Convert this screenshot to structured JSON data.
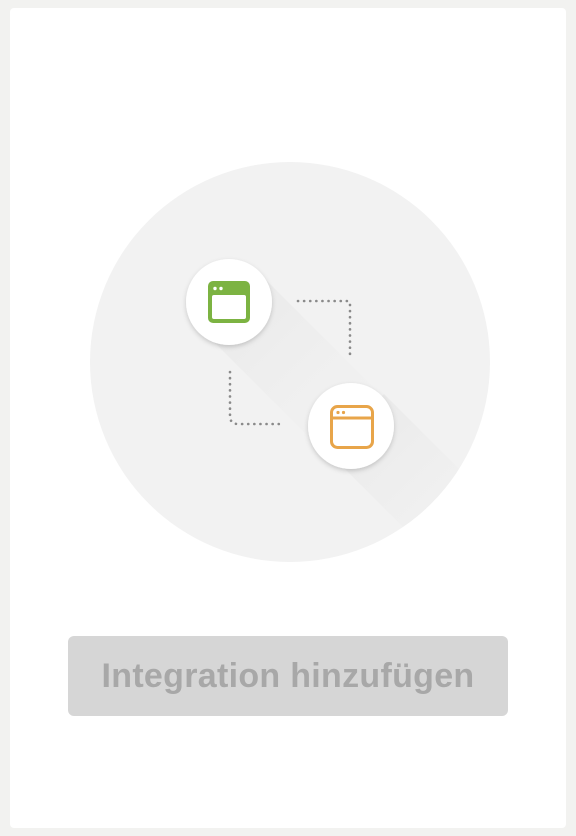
{
  "integration_card": {
    "add_button_label": "Integration hinzufügen",
    "add_button_state": "disabled",
    "illustration": {
      "source_app_icon": "browser-window-icon",
      "source_app_color": "#7cb342",
      "target_app_icon": "browser-window-icon",
      "target_app_color": "#e8a54a",
      "connector": "dotted-line",
      "background_color": "#f2f2f2"
    }
  }
}
